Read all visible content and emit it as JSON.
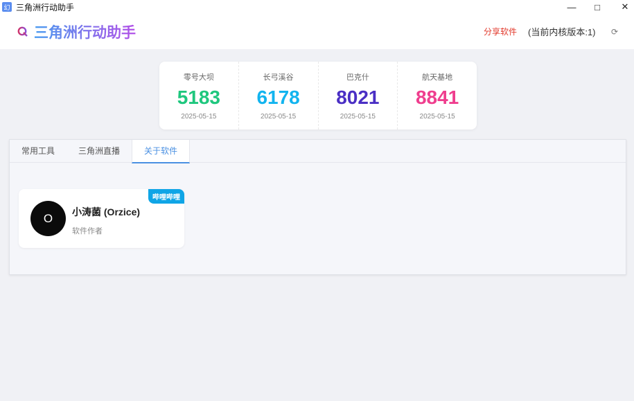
{
  "window": {
    "title": "三角洲行动助手",
    "icon_text": "幻"
  },
  "header": {
    "app_name": "三角洲行动助手",
    "share_label": "分享软件",
    "version_label": "(当前内核版本:1)"
  },
  "stats": [
    {
      "name": "零号大坝",
      "value": "5183",
      "date": "2025-05-15",
      "color": "#1fc77e"
    },
    {
      "name": "长弓溪谷",
      "value": "6178",
      "date": "2025-05-15",
      "color": "#12b4ef"
    },
    {
      "name": "巴克什",
      "value": "8021",
      "date": "2025-05-15",
      "color": "#4a2fc4"
    },
    {
      "name": "航天基地",
      "value": "8841",
      "date": "2025-05-15",
      "color": "#ef3e8e"
    }
  ],
  "tabs": [
    {
      "label": "常用工具"
    },
    {
      "label": "三角洲直播"
    },
    {
      "label": "关于软件"
    }
  ],
  "author": {
    "initial": "O",
    "name": "小涛菌 (Orzice)",
    "role": "软件作者",
    "badge": "哔哩哔哩"
  }
}
